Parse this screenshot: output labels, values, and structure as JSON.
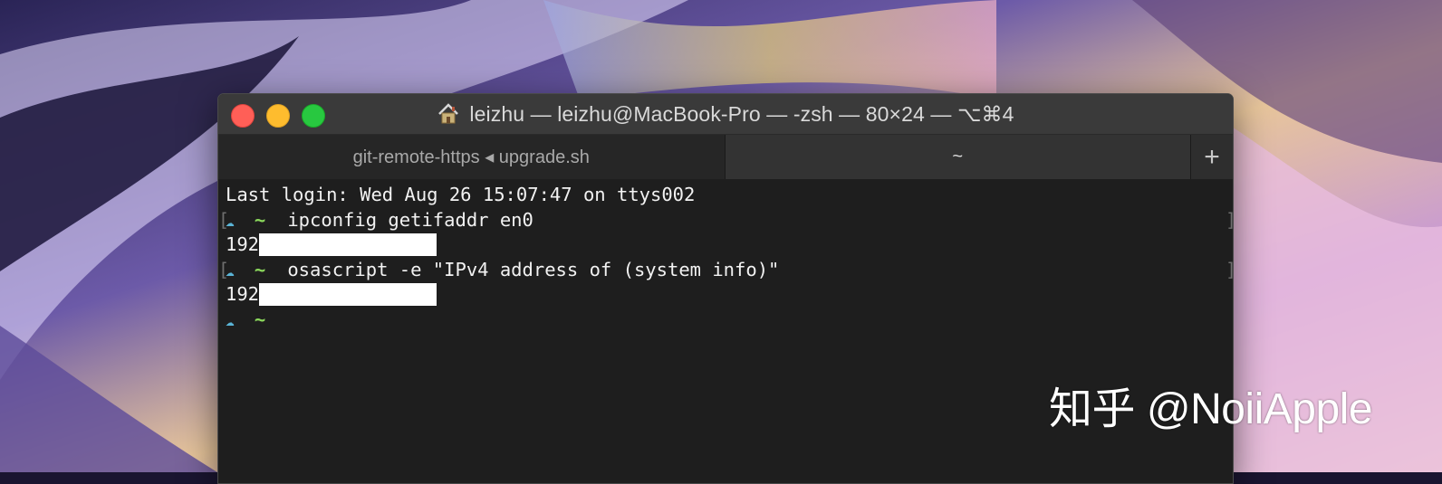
{
  "window": {
    "title": "leizhu — leizhu@MacBook-Pro — -zsh — 80×24 — ⌥⌘4",
    "home_icon": "house-icon"
  },
  "tabs": [
    {
      "label": "git-remote-https ◂ upgrade.sh",
      "active": false
    },
    {
      "label": "~",
      "active": true
    }
  ],
  "new_tab_label": "+",
  "terminal": {
    "last_login": "Last login: Wed Aug 26 15:07:47 on ttys002",
    "prompt_icon": "☁",
    "prompt_dir": "~",
    "commands": [
      {
        "command": "ipconfig getifaddr en0",
        "output_prefix": "192"
      },
      {
        "command": "osascript -e \"IPv4 address of (system info)\"",
        "output_prefix": "192"
      }
    ]
  },
  "watermark": "知乎 @NoiiApple",
  "colors": {
    "prompt_cloud": "#5ab4d6",
    "prompt_tilde": "#8bd85c",
    "terminal_bg": "#1e1e1e"
  }
}
